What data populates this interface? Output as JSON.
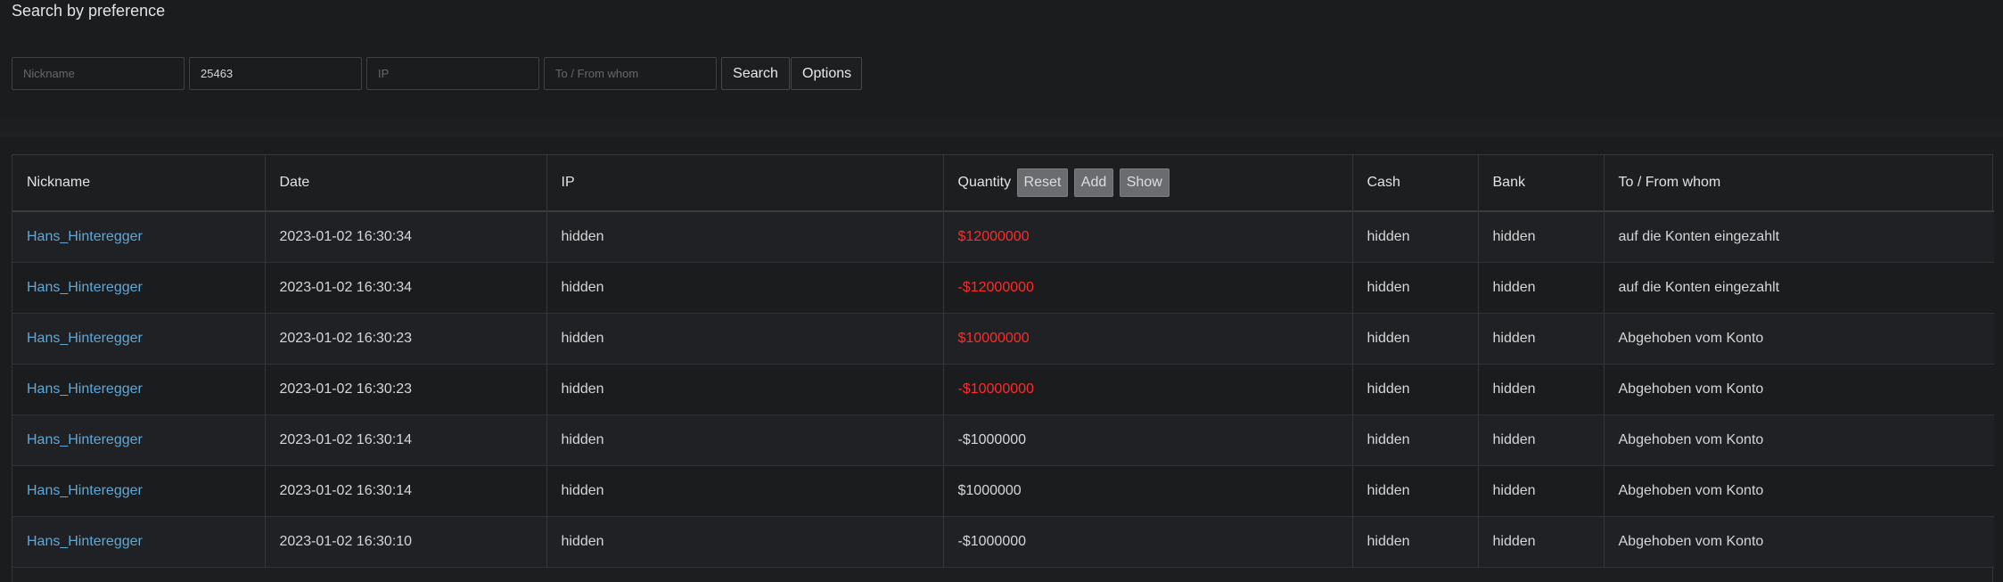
{
  "page_title": "Search by preference",
  "filters": {
    "nickname": {
      "value": "",
      "placeholder": "Nickname"
    },
    "id": {
      "value": "25463",
      "placeholder": ""
    },
    "ip": {
      "value": "",
      "placeholder": "IP"
    },
    "to_from": {
      "value": "",
      "placeholder": "To / From whom"
    },
    "search_label": "Search",
    "options_label": "Options"
  },
  "table": {
    "columns": {
      "nickname": "Nickname",
      "date": "Date",
      "ip": "IP",
      "quantity": "Quantity",
      "cash": "Cash",
      "bank": "Bank",
      "to_from": "To / From whom"
    },
    "quantity_buttons": {
      "reset": "Reset",
      "add": "Add",
      "show": "Show"
    },
    "colors": {
      "link": "#5fa8d8",
      "negative_highlight": "#ff2a2a"
    },
    "rows": [
      {
        "nickname": "Hans_Hinteregger",
        "date": "2023-01-02 16:30:34",
        "ip": "hidden",
        "quantity": "$12000000",
        "highlight": true,
        "cash": "hidden",
        "bank": "hidden",
        "to_from": "auf die Konten eingezahlt"
      },
      {
        "nickname": "Hans_Hinteregger",
        "date": "2023-01-02 16:30:34",
        "ip": "hidden",
        "quantity": "-$12000000",
        "highlight": true,
        "cash": "hidden",
        "bank": "hidden",
        "to_from": "auf die Konten eingezahlt"
      },
      {
        "nickname": "Hans_Hinteregger",
        "date": "2023-01-02 16:30:23",
        "ip": "hidden",
        "quantity": "$10000000",
        "highlight": true,
        "cash": "hidden",
        "bank": "hidden",
        "to_from": "Abgehoben vom Konto"
      },
      {
        "nickname": "Hans_Hinteregger",
        "date": "2023-01-02 16:30:23",
        "ip": "hidden",
        "quantity": "-$10000000",
        "highlight": true,
        "cash": "hidden",
        "bank": "hidden",
        "to_from": "Abgehoben vom Konto"
      },
      {
        "nickname": "Hans_Hinteregger",
        "date": "2023-01-02 16:30:14",
        "ip": "hidden",
        "quantity": "-$1000000",
        "highlight": false,
        "cash": "hidden",
        "bank": "hidden",
        "to_from": "Abgehoben vom Konto"
      },
      {
        "nickname": "Hans_Hinteregger",
        "date": "2023-01-02 16:30:14",
        "ip": "hidden",
        "quantity": "$1000000",
        "highlight": false,
        "cash": "hidden",
        "bank": "hidden",
        "to_from": "Abgehoben vom Konto"
      },
      {
        "nickname": "Hans_Hinteregger",
        "date": "2023-01-02 16:30:10",
        "ip": "hidden",
        "quantity": "-$1000000",
        "highlight": false,
        "cash": "hidden",
        "bank": "hidden",
        "to_from": "Abgehoben vom Konto"
      }
    ]
  }
}
